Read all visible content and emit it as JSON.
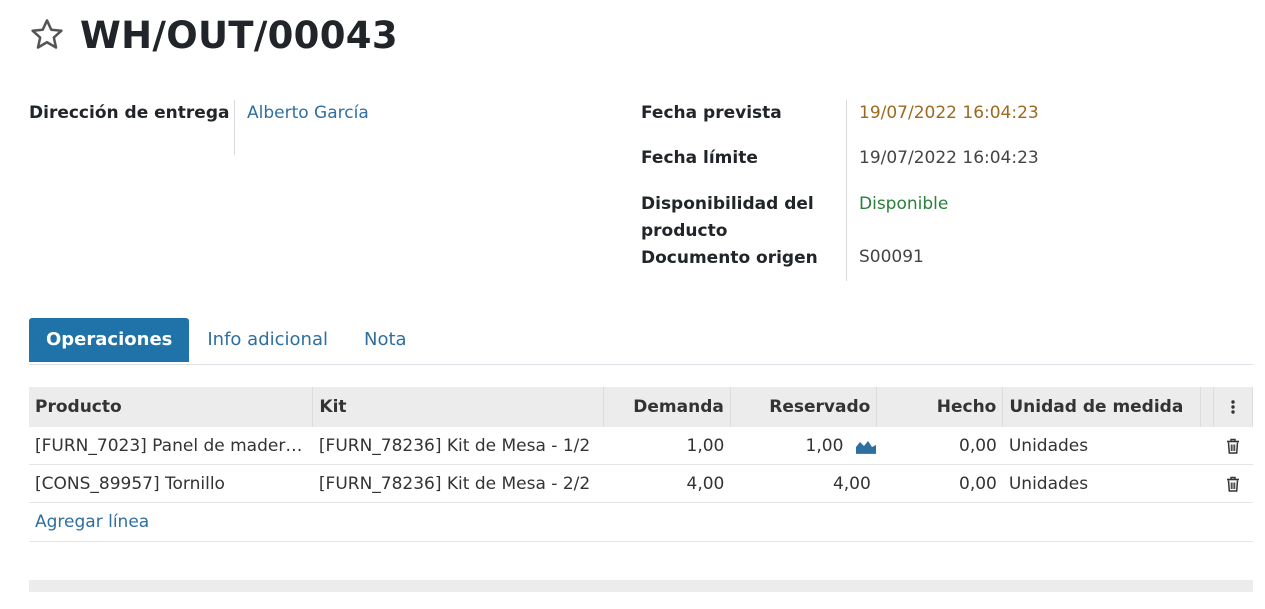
{
  "record": {
    "title": "WH/OUT/00043"
  },
  "fields": {
    "delivery_address_label": "Dirección de entrega",
    "delivery_address_value": "Alberto García",
    "scheduled_date_label": "Fecha prevista",
    "scheduled_date_value": "19/07/2022 16:04:23",
    "deadline_label": "Fecha límite",
    "deadline_value": "19/07/2022 16:04:23",
    "availability_label": "Disponibilidad del producto",
    "availability_value": "Disponible",
    "origin_label": "Documento origen",
    "origin_value": "S00091"
  },
  "tabs": [
    {
      "label": "Operaciones",
      "active": true
    },
    {
      "label": "Info adicional",
      "active": false
    },
    {
      "label": "Nota",
      "active": false
    }
  ],
  "table": {
    "headers": {
      "product": "Producto",
      "kit": "Kit",
      "demand": "Demanda",
      "reserved": "Reservado",
      "done": "Hecho",
      "uom": "Unidad de medida"
    },
    "rows": [
      {
        "product": "[FURN_7023] Panel de mader…",
        "kit": "[FURN_78236] Kit de Mesa - 1/2",
        "demand": "1,00",
        "reserved": "1,00",
        "done": "0,00",
        "uom": "Unidades",
        "forecast": true
      },
      {
        "product": "[CONS_89957] Tornillo",
        "kit": "[FURN_78236] Kit de Mesa - 2/2",
        "demand": "4,00",
        "reserved": "4,00",
        "done": "0,00",
        "uom": "Unidades",
        "forecast": false
      }
    ],
    "add_line": "Agregar línea"
  },
  "colors": {
    "link": "#2f6fa0",
    "warning": "#9c6a1f",
    "success": "#28803a",
    "tab_active_bg": "#1f73a8",
    "header_bg": "#ececec"
  },
  "icons": [
    "star-icon",
    "forecast-chart-icon",
    "trash-icon",
    "kebab-menu-icon"
  ]
}
